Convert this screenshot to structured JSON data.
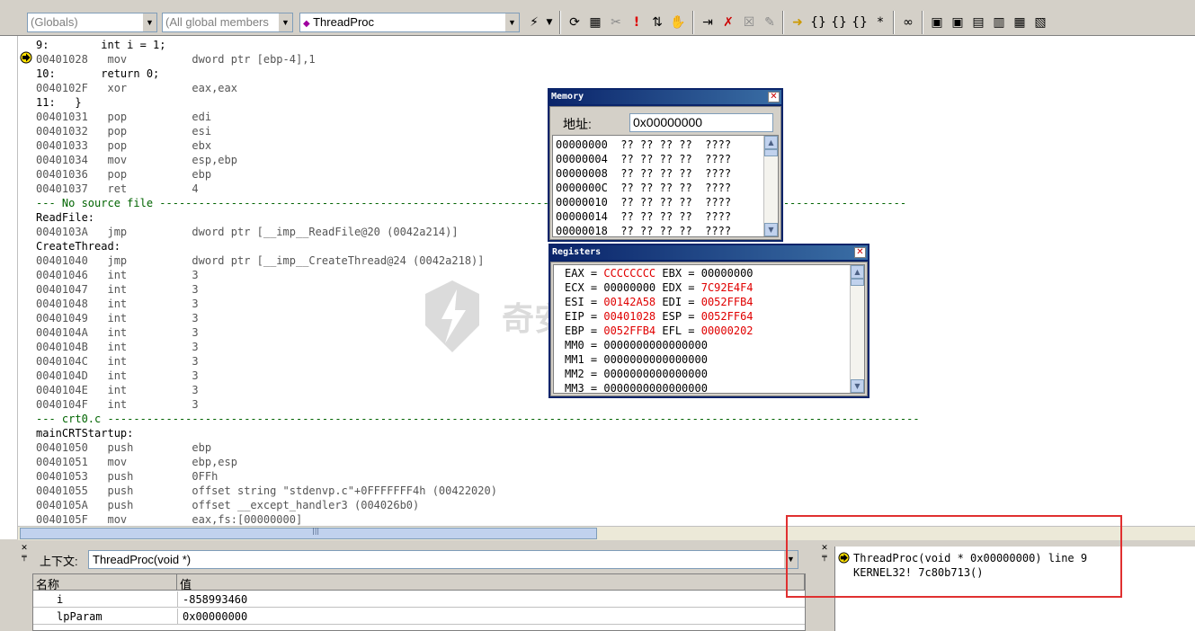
{
  "toolbar": {
    "scope_combo": "(Globals)",
    "members_combo": "(All global members",
    "function_combo": "ThreadProc"
  },
  "disassembly": [
    {
      "type": "src",
      "text": "9:        int i = 1;"
    },
    {
      "type": "code",
      "text": "00401028   mov          dword ptr [ebp-4],1"
    },
    {
      "type": "src",
      "text": "10:       return 0;"
    },
    {
      "type": "code",
      "text": "0040102F   xor          eax,eax"
    },
    {
      "type": "src",
      "text": "11:   }"
    },
    {
      "type": "code",
      "text": "00401031   pop          edi"
    },
    {
      "type": "code",
      "text": "00401032   pop          esi"
    },
    {
      "type": "code",
      "text": "00401033   pop          ebx"
    },
    {
      "type": "code",
      "text": "00401034   mov          esp,ebp"
    },
    {
      "type": "code",
      "text": "00401036   pop          ebp"
    },
    {
      "type": "code",
      "text": "00401037   ret          4"
    },
    {
      "type": "sep",
      "text": "--- No source file -------------------------------------------------------------------------------------------------------------------"
    },
    {
      "type": "lbl",
      "text": "ReadFile:"
    },
    {
      "type": "code",
      "text": "0040103A   jmp          dword ptr [__imp__ReadFile@20 (0042a214)]"
    },
    {
      "type": "lbl",
      "text": "CreateThread:"
    },
    {
      "type": "code",
      "text": "00401040   jmp          dword ptr [__imp__CreateThread@24 (0042a218)]"
    },
    {
      "type": "code",
      "text": "00401046   int          3"
    },
    {
      "type": "code",
      "text": "00401047   int          3"
    },
    {
      "type": "code",
      "text": "00401048   int          3"
    },
    {
      "type": "code",
      "text": "00401049   int          3"
    },
    {
      "type": "code",
      "text": "0040104A   int          3"
    },
    {
      "type": "code",
      "text": "0040104B   int          3"
    },
    {
      "type": "code",
      "text": "0040104C   int          3"
    },
    {
      "type": "code",
      "text": "0040104D   int          3"
    },
    {
      "type": "code",
      "text": "0040104E   int          3"
    },
    {
      "type": "code",
      "text": "0040104F   int          3"
    },
    {
      "type": "sep",
      "text": "--- crt0.c -----------------------------------------------------------------------------------------------------------------------------"
    },
    {
      "type": "lbl",
      "text": "mainCRTStartup:"
    },
    {
      "type": "code",
      "text": "00401050   push         ebp"
    },
    {
      "type": "code",
      "text": "00401051   mov          ebp,esp"
    },
    {
      "type": "code",
      "text": "00401053   push         0FFh"
    },
    {
      "type": "code",
      "text": "00401055   push         offset string \"stdenvp.c\"+0FFFFFFF4h (00422020)"
    },
    {
      "type": "code",
      "text": "0040105A   push         offset __except_handler3 (004026b0)"
    },
    {
      "type": "code",
      "text": "0040105F   mov          eax,fs:[00000000]"
    }
  ],
  "memory": {
    "title": "Memory",
    "address_label": "地址:",
    "address_value": "0x00000000",
    "rows": [
      "00000000  ?? ?? ?? ??  ????",
      "00000004  ?? ?? ?? ??  ????",
      "00000008  ?? ?? ?? ??  ????",
      "0000000C  ?? ?? ?? ??  ????",
      "00000010  ?? ?? ?? ??  ????",
      "00000014  ?? ?? ?? ??  ????",
      "00000018  ?? ?? ?? ??  ????"
    ]
  },
  "registers": {
    "title": "Registers",
    "rows": [
      [
        {
          "t": "EAX = "
        },
        {
          "t": "CCCCCCCC",
          "red": true
        },
        {
          "t": " EBX = "
        },
        {
          "t": "00000000"
        }
      ],
      [
        {
          "t": "ECX = "
        },
        {
          "t": "00000000"
        },
        {
          "t": " EDX = "
        },
        {
          "t": "7C92E4F4",
          "red": true
        }
      ],
      [
        {
          "t": "ESI = "
        },
        {
          "t": "00142A58",
          "red": true
        },
        {
          "t": " EDI = "
        },
        {
          "t": "0052FFB4",
          "red": true
        }
      ],
      [
        {
          "t": "EIP = "
        },
        {
          "t": "00401028",
          "red": true
        },
        {
          "t": " ESP = "
        },
        {
          "t": "0052FF64",
          "red": true
        }
      ],
      [
        {
          "t": "EBP = "
        },
        {
          "t": "0052FFB4",
          "red": true
        },
        {
          "t": " EFL = "
        },
        {
          "t": "00000202",
          "red": true
        }
      ],
      [
        {
          "t": "MM0 = 0000000000000000"
        }
      ],
      [
        {
          "t": "MM1 = 0000000000000000"
        }
      ],
      [
        {
          "t": "MM2 = 0000000000000000"
        }
      ],
      [
        {
          "t": "MM3 = 0000000000000000"
        }
      ]
    ]
  },
  "context": {
    "label": "上下文:",
    "value": "ThreadProc(void *)"
  },
  "variables": {
    "col_name": "名称",
    "col_value": "值",
    "rows": [
      {
        "name": "i",
        "value": "-858993460"
      },
      {
        "name": "lpParam",
        "value": "0x00000000"
      }
    ]
  },
  "callstack": [
    "ThreadProc(void * 0x00000000) line 9",
    "KERNEL32! 7c80b713()"
  ],
  "watermark": "奇安信攻防社区",
  "colors": {
    "changed_register": "#e00000",
    "title_bar": "#0a246a",
    "highlight_box": "#e03030"
  }
}
